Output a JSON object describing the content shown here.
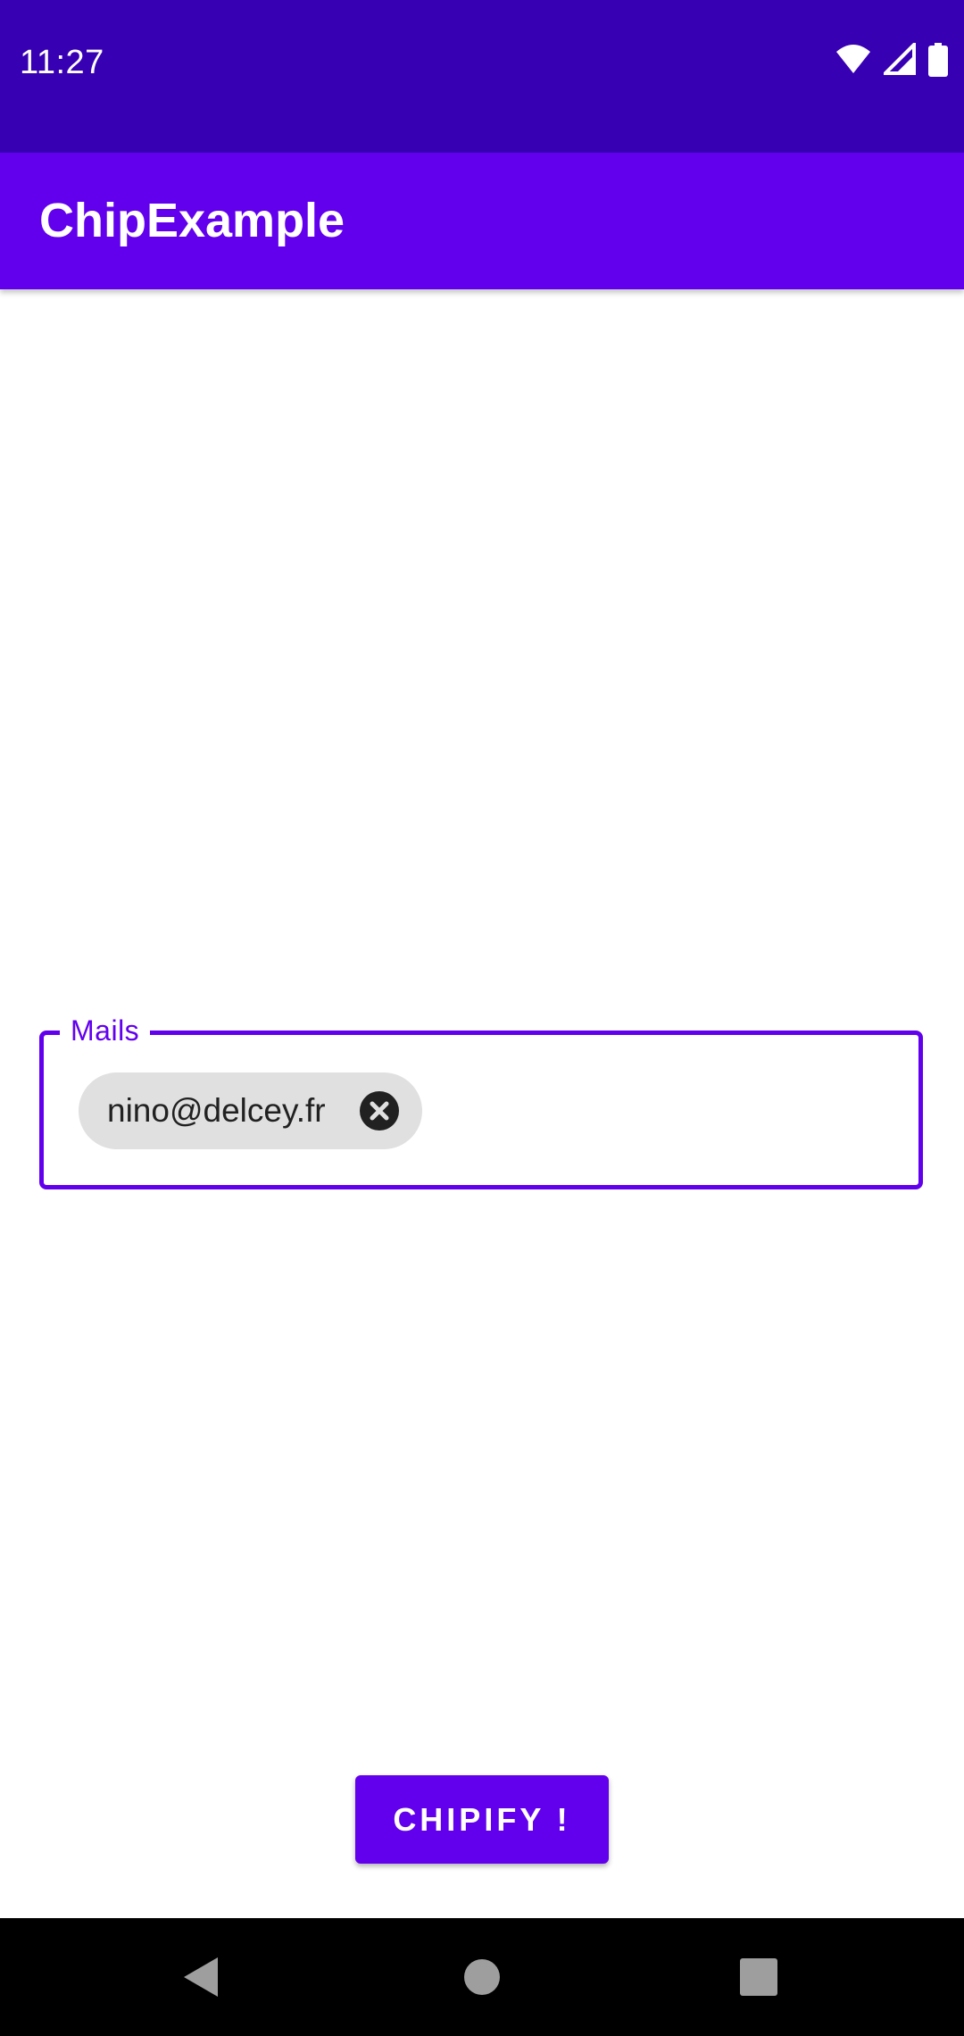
{
  "status_bar": {
    "time": "11:27",
    "icons": [
      "wifi-icon",
      "cell-signal-icon",
      "battery-icon"
    ],
    "background": "#3700b3"
  },
  "app_bar": {
    "title": "ChipExample",
    "background": "#6200ee"
  },
  "mails_field": {
    "label": "Mails",
    "chips": [
      {
        "label": "nino@delcey.fr",
        "close_icon": "cancel-icon"
      }
    ],
    "accent": "#6200ee"
  },
  "chipify_button": {
    "label": "CHIPIFY !"
  },
  "nav_bar": {
    "icons": [
      "back-icon",
      "home-icon",
      "recents-icon"
    ]
  }
}
